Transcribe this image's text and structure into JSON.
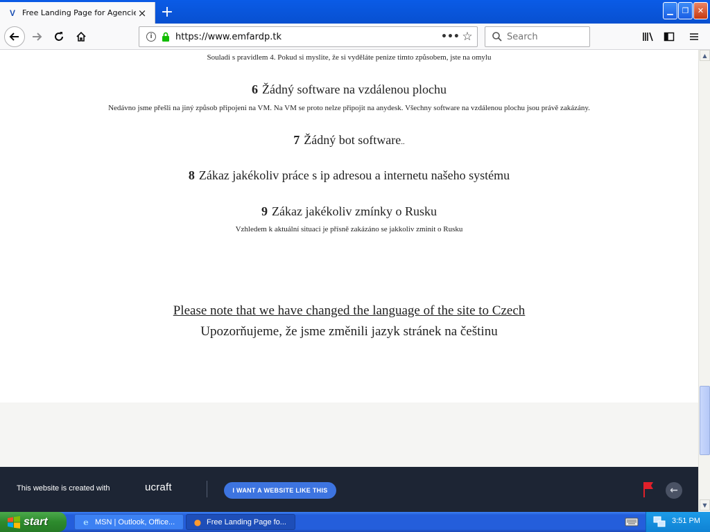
{
  "browser": {
    "tab": {
      "title": "Free Landing Page for Agencies - ucraft",
      "favicon": "ucraft-favicon",
      "close": "×"
    },
    "new_tab": "+",
    "window_controls": {
      "minimize": "_",
      "maximize": "❐",
      "close": "✕"
    },
    "url": "https://www.emfardp.tk",
    "search_placeholder": "Search"
  },
  "page": {
    "rule5_desc": "Souladi s pravidlem 4. Pokud si myslite, že si vyděláte penize timto způsobem, jste na omylu",
    "rules": [
      {
        "number": "6",
        "title": "Žádný software na vzdálenou plochu",
        "desc": "Nedávno jsme přešli na jiný způsob připojeni na VM. Na VM se proto nelze připojit na anydesk. Všechny software na vzdálenou plochu jsou právě zakázány."
      },
      {
        "number": "7",
        "title": "Žádný bot software",
        "suffix": ".."
      },
      {
        "number": "8",
        "title": "Zákaz jakékoliv práce s ip adresou a internetu našeho systému"
      },
      {
        "number": "9",
        "title": "Zákaz jakékoliv zmínky o Rusku",
        "desc": "Vzhledem k aktuální situaci je přísně zakázáno se jakkoliv zminit o Rusku"
      }
    ],
    "note_en": "Please note that we have changed the language of the site to Czech",
    "note_cz": "Upozorňujeme, že jsme změnili jazyk stránek na češtinu"
  },
  "ucraft_banner": {
    "text": "This website is created with",
    "logo": "ucraft",
    "cta": "I WANT A WEBSITE LIKE THIS",
    "flag_color": "#e0202a"
  },
  "taskbar": {
    "start": "start",
    "tasks": [
      {
        "label": "MSN | Outlook, Office...",
        "icon": "ie-icon",
        "active": false
      },
      {
        "label": "Free Landing Page fo...",
        "icon": "firefox-icon",
        "active": true
      }
    ],
    "clock": "3:51 PM"
  }
}
